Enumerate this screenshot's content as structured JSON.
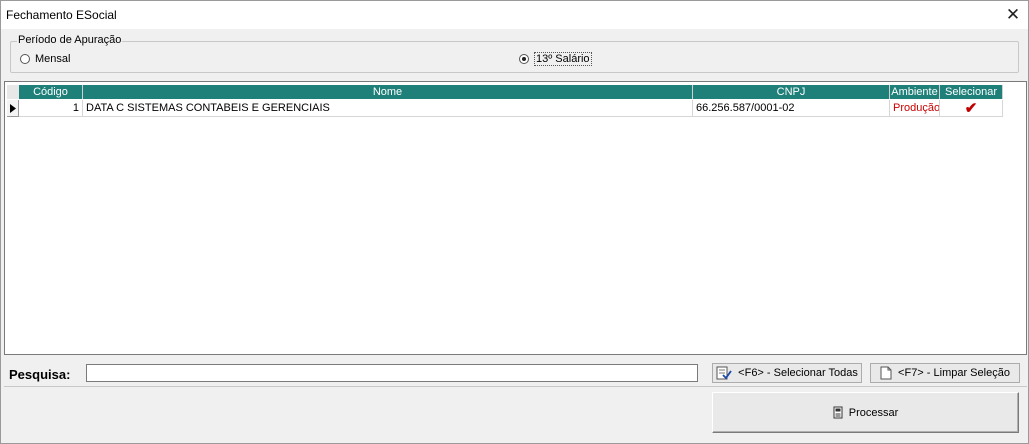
{
  "window": {
    "title": "Fechamento ESocial",
    "close_glyph": "✕"
  },
  "period": {
    "legend": "Período de Apuração",
    "options": [
      {
        "label": "Mensal",
        "selected": false
      },
      {
        "label": "13º Salário",
        "selected": true
      }
    ]
  },
  "grid": {
    "columns": [
      "Código",
      "Nome",
      "CNPJ",
      "Ambiente",
      "Selecionar"
    ],
    "rows": [
      {
        "codigo": "1",
        "nome": "DATA C SISTEMAS CONTABEIS E GERENCIAIS",
        "cnpj": "66.256.587/0001-02",
        "ambiente": "Produção",
        "selecionar": "✔"
      }
    ],
    "header_color": "#1f7f79",
    "ambiente_color": "#cc0000"
  },
  "search": {
    "label": "Pesquisa:",
    "value": ""
  },
  "buttons": {
    "select_all": "<F6> - Selecionar Todas",
    "clear_selection": "<F7> - Limpar Seleção",
    "process": "Processar"
  }
}
